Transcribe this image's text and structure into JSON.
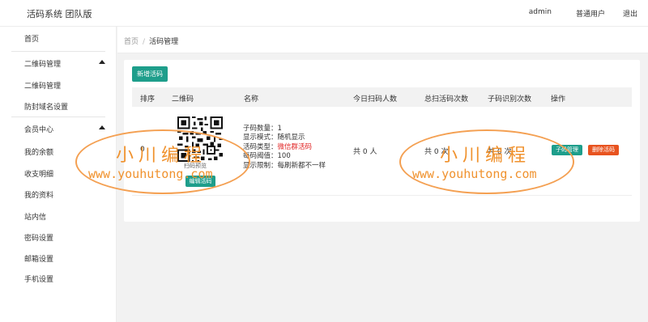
{
  "app": {
    "title": "活码系统 团队版"
  },
  "topnav": {
    "user": "admin",
    "role": "普通用户",
    "logout": "退出"
  },
  "sidebar": {
    "home": "首页",
    "groups": [
      {
        "label": "二维码管理",
        "items": [
          "二维码管理",
          "防封域名设置"
        ]
      },
      {
        "label": "会员中心",
        "items": [
          "我的余额",
          "收支明细",
          "我的资料",
          "站内信",
          "密码设置",
          "邮箱设置",
          "手机设置"
        ]
      }
    ]
  },
  "breadcrumb": {
    "home": "首页",
    "sep": "/",
    "current": "活码管理"
  },
  "toolbar": {
    "new_button": "新增活码"
  },
  "table": {
    "headers": [
      "排序",
      "二维码",
      "名称",
      "今日扫码人数",
      "总扫活码次数",
      "子码识别次数",
      "操作"
    ],
    "rows": [
      {
        "order": "0",
        "qr_caption": "扫码预览",
        "edit_button": "编辑活码",
        "info": {
          "count": "子码数量：1",
          "mode": "显示模式：随机显示",
          "type_label": "活码类型：",
          "type_value": "微信群活码",
          "threshold": "每码阈值：100",
          "limit": "显示限制：每刷新都不一样"
        },
        "today_scans": "共 0 人",
        "total_scans": "共 0 次",
        "sub_scans": "共 0 次",
        "sub_button": "子码管理",
        "delete_button": "删除活码"
      }
    ]
  },
  "watermark": {
    "cn": "小川编程",
    "url": "www.youhutong.com"
  },
  "colors": {
    "accent": "#1e9e8b",
    "danger": "#e8531f",
    "highlight": "#e02222",
    "watermark": "#f0922e"
  }
}
